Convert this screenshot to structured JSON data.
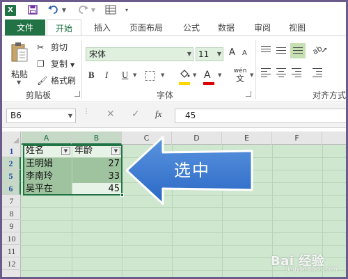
{
  "qat": {
    "app_logo": "X",
    "icons": [
      "excel-logo-icon",
      "save-icon",
      "undo-icon",
      "redo-icon",
      "form-icon"
    ]
  },
  "tabs": [
    {
      "label": "文件",
      "active": false
    },
    {
      "label": "开始",
      "active": true
    },
    {
      "label": "插入",
      "active": false
    },
    {
      "label": "页面布局",
      "active": false
    },
    {
      "label": "公式",
      "active": false
    },
    {
      "label": "数据",
      "active": false
    },
    {
      "label": "审阅",
      "active": false
    },
    {
      "label": "视图",
      "active": false
    }
  ],
  "ribbon": {
    "clipboard": {
      "paste": "粘贴",
      "cut": "剪切",
      "copy": "复制",
      "format_painter": "格式刷",
      "group_label": "剪贴板"
    },
    "font": {
      "font_name": "宋体",
      "font_size": "11",
      "bold": "B",
      "italic": "I",
      "underline": "U",
      "phonetic": "wén",
      "phonetic_sub": "文",
      "font_color_glyph": "A",
      "grow_glyph": "A",
      "shrink_glyph": "A",
      "group_label": "字体"
    },
    "alignment": {
      "group_label": "对齐方式"
    }
  },
  "formula_bar": {
    "name_box": "B6",
    "cancel": "✕",
    "enter": "✓",
    "fx": "fx",
    "value": "45"
  },
  "grid": {
    "columns": [
      "A",
      "B",
      "C",
      "D",
      "E",
      "F"
    ],
    "selected_columns": [
      "A",
      "B"
    ],
    "rows": [
      "1",
      "2",
      "5",
      "6",
      "7",
      "8",
      "9",
      "10",
      "11",
      "12"
    ],
    "selected_rows": [
      "2",
      "5",
      "6"
    ],
    "header_row": {
      "name": "姓名",
      "age": "年龄"
    },
    "data_rows": [
      {
        "name": "王明娟",
        "age": "27"
      },
      {
        "name": "李南玲",
        "age": "33"
      },
      {
        "name": "吴平在",
        "age": "45"
      }
    ]
  },
  "callout": {
    "text": "选中",
    "fill_color": "#3b7ed8"
  },
  "watermark": {
    "text": "Bai 经验",
    "sub": "jingyan.baidu.com"
  }
}
